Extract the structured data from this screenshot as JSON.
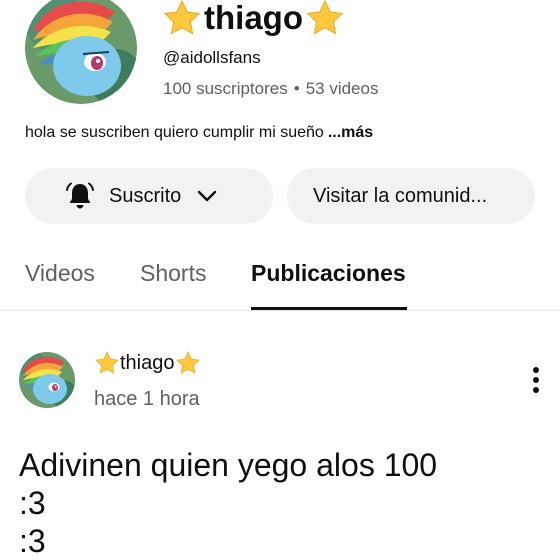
{
  "channel": {
    "name": "thiago",
    "handle": "@aidollsfans",
    "subscribers": "100 suscriptores",
    "separator": "•",
    "videos": "53 videos",
    "description": "hola se suscriben quiero cumplir mi sueño",
    "more_label": "...más"
  },
  "actions": {
    "subscribed_label": "Suscrito",
    "visit_label": "Visitar la comunid..."
  },
  "tabs": [
    {
      "label": "Videos",
      "active": false
    },
    {
      "label": "Shorts",
      "active": false
    },
    {
      "label": "Publicaciones",
      "active": true
    }
  ],
  "post": {
    "author": "thiago",
    "time": "hace 1 hora",
    "lines": [
      "Adivinen quien yego alos 100",
      ":3",
      ":3"
    ]
  },
  "icons": {
    "star": "star-icon",
    "bell": "bell-icon",
    "chevron": "chevron-down-icon",
    "more": "more-vert-icon"
  },
  "colors": {
    "star": "#FFC83D",
    "pill_bg": "#F2F2F2",
    "secondary_text": "#606060"
  }
}
